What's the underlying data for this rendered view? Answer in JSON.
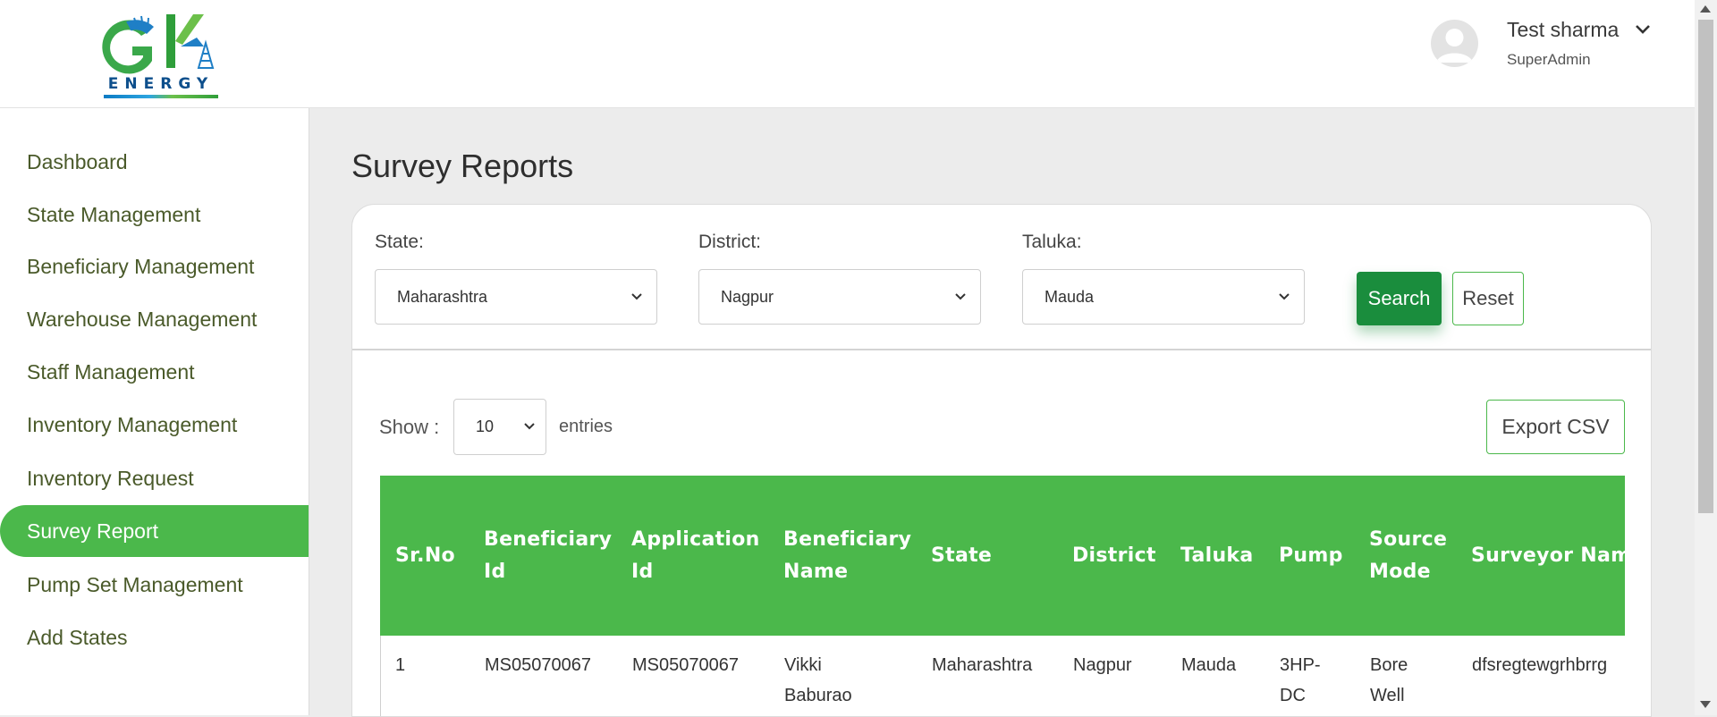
{
  "header": {
    "logo_text": "ENERGY",
    "user_name": "Test sharma",
    "user_role": "SuperAdmin"
  },
  "sidebar": {
    "items": [
      {
        "label": "Dashboard"
      },
      {
        "label": "State Management"
      },
      {
        "label": "Beneficiary Management"
      },
      {
        "label": "Warehouse Management"
      },
      {
        "label": "Staff Management"
      },
      {
        "label": "Inventory Management"
      },
      {
        "label": "Inventory Request"
      },
      {
        "label": "Survey Report",
        "active": true
      },
      {
        "label": "Pump Set Management"
      },
      {
        "label": "Add States"
      }
    ]
  },
  "main": {
    "title": "Survey Reports",
    "filters": {
      "state_label": "State:",
      "state_value": "Maharashtra",
      "district_label": "District:",
      "district_value": "Nagpur",
      "taluka_label": "Taluka:",
      "taluka_value": "Mauda",
      "search_label": "Search",
      "reset_label": "Reset"
    },
    "show_label": "Show :",
    "entries_value": "10",
    "entries_label": "entries",
    "export_label": "Export CSV",
    "table": {
      "headers": [
        "Sr.No",
        "Beneficiary Id",
        "Application Id",
        "Beneficiary Name",
        "State",
        "District",
        "Taluka",
        "Pump",
        "Source Mode",
        "Surveyor Name"
      ],
      "rows": [
        [
          "1",
          "MS05070067",
          "MS05070067",
          "Vikki Baburao",
          "Maharashtra",
          "Nagpur",
          "Mauda",
          "3HP-DC",
          "Bore Well",
          "dfsregtewgrhbrrg"
        ]
      ]
    }
  },
  "colors": {
    "accent_green": "#4bb84b",
    "button_green": "#1a8d3d"
  }
}
